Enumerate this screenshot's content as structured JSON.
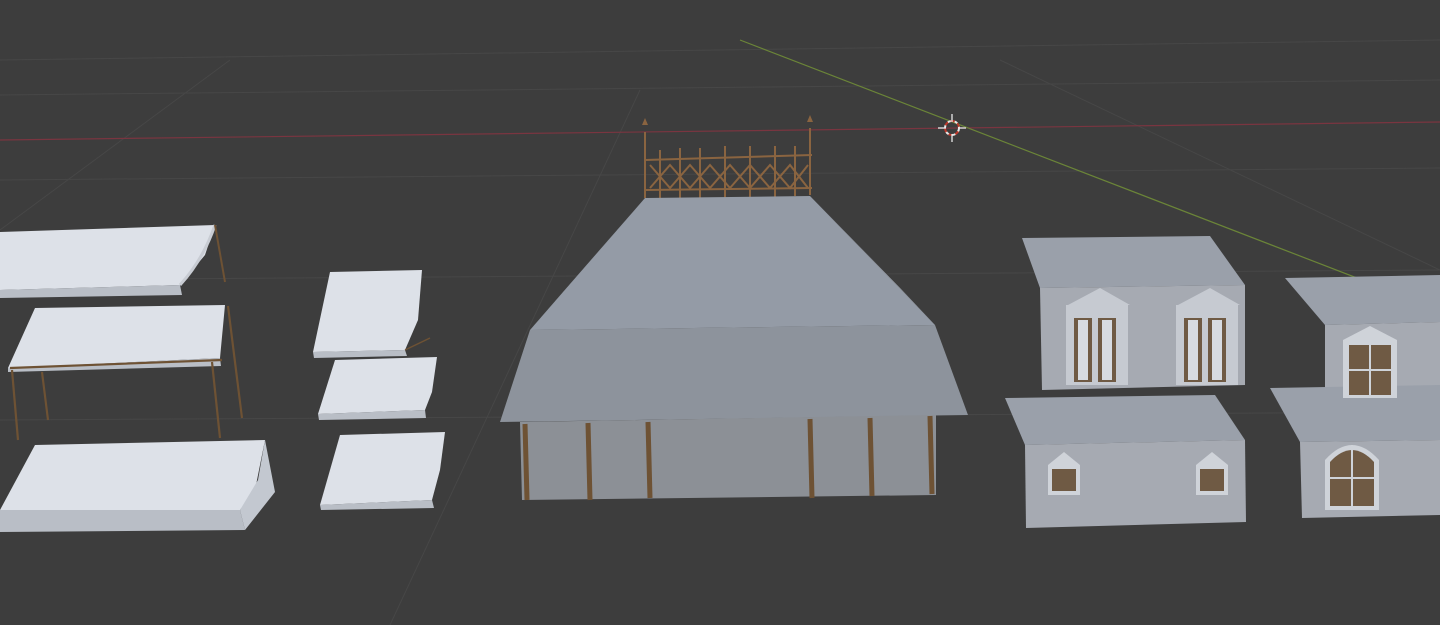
{
  "viewport": {
    "name": "3D Viewport",
    "background": "#3d3d3d",
    "grid_color": "#4a4a4a",
    "x_axis_color": "#8a3a46",
    "y_axis_color": "#6d8a3a",
    "cursor_icon": "3d-cursor-icon"
  },
  "objects": [
    {
      "id": "awning-large-1",
      "kind": "awning"
    },
    {
      "id": "awning-frame-2",
      "kind": "awning-with-frame"
    },
    {
      "id": "awning-large-3",
      "kind": "awning"
    },
    {
      "id": "awning-small-1",
      "kind": "awning"
    },
    {
      "id": "awning-small-2",
      "kind": "awning"
    },
    {
      "id": "awning-small-3",
      "kind": "awning"
    },
    {
      "id": "pavilion-roof",
      "kind": "roof-with-railing"
    },
    {
      "id": "dormer-roof-double",
      "kind": "roof-with-dormers"
    },
    {
      "id": "dormer-roof-small",
      "kind": "roof-with-dormers"
    },
    {
      "id": "mansard-roof-partial",
      "kind": "roof-with-windows"
    }
  ],
  "colors": {
    "canvas": "#dfe3ea",
    "canvas_shade": "#c6cbd3",
    "roof_top": "#9198a3",
    "roof_side": "#8a909a",
    "wood": "#7a5a3a",
    "glass": "#8c8f94",
    "wall": "#a6aab2"
  }
}
